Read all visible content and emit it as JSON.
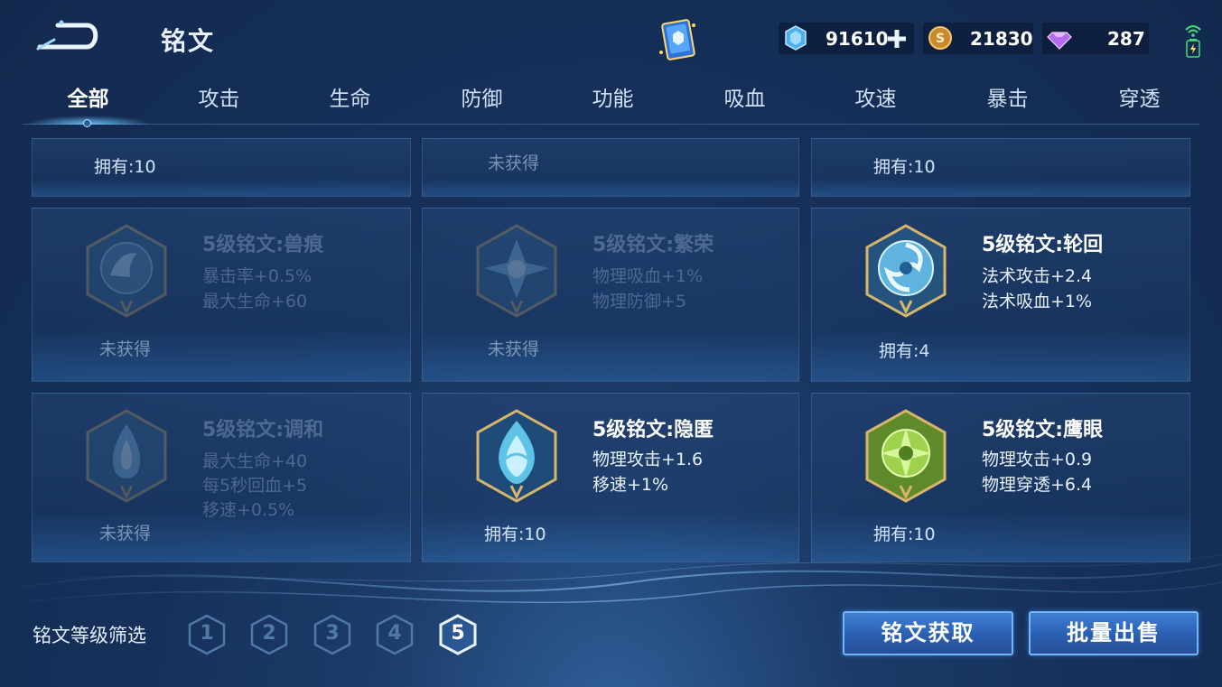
{
  "header": {
    "title": "铭文",
    "currencies": {
      "crystal": "91610",
      "gold": "21830",
      "gem": "287"
    }
  },
  "tabs": [
    "全部",
    "攻击",
    "生命",
    "防御",
    "功能",
    "吸血",
    "攻速",
    "暴击",
    "穿透"
  ],
  "active_tab": "全部",
  "top_row": [
    {
      "owned": "拥有:10"
    },
    {
      "owned": "未获得"
    },
    {
      "owned": "拥有:10"
    }
  ],
  "cards": [
    {
      "name": "5级铭文:兽痕",
      "attrs": [
        "暴击率+0.5%",
        "最大生命+60"
      ],
      "owned": "未获得",
      "obtained": false,
      "icon": "beast-mark-rune-icon"
    },
    {
      "name": "5级铭文:繁荣",
      "attrs": [
        "物理吸血+1%",
        "物理防御+5"
      ],
      "owned": "未获得",
      "obtained": false,
      "icon": "prosperity-rune-icon"
    },
    {
      "name": "5级铭文:轮回",
      "attrs": [
        "法术攻击+2.4",
        "法术吸血+1%"
      ],
      "owned": "拥有:4",
      "obtained": true,
      "icon": "reincarnation-rune-icon"
    },
    {
      "name": "5级铭文:调和",
      "attrs": [
        "最大生命+40",
        "每5秒回血+5",
        "移速+0.5%"
      ],
      "owned": "未获得",
      "obtained": false,
      "icon": "harmony-rune-icon"
    },
    {
      "name": "5级铭文:隐匿",
      "attrs": [
        "物理攻击+1.6",
        "移速+1%"
      ],
      "owned": "拥有:10",
      "obtained": true,
      "icon": "stealth-rune-icon"
    },
    {
      "name": "5级铭文:鹰眼",
      "attrs": [
        "物理攻击+0.9",
        "物理穿透+6.4"
      ],
      "owned": "拥有:10",
      "obtained": true,
      "icon": "eagle-eye-rune-icon"
    }
  ],
  "filter": {
    "label": "铭文等级筛选",
    "levels": [
      "1",
      "2",
      "3",
      "4",
      "5"
    ],
    "selected": "5"
  },
  "buttons": {
    "acquire": "铭文获取",
    "sell": "批量出售"
  },
  "colors": {
    "accent": "#3f7fd3",
    "gold_frame": "#c9a35a",
    "background": "#16305a"
  }
}
